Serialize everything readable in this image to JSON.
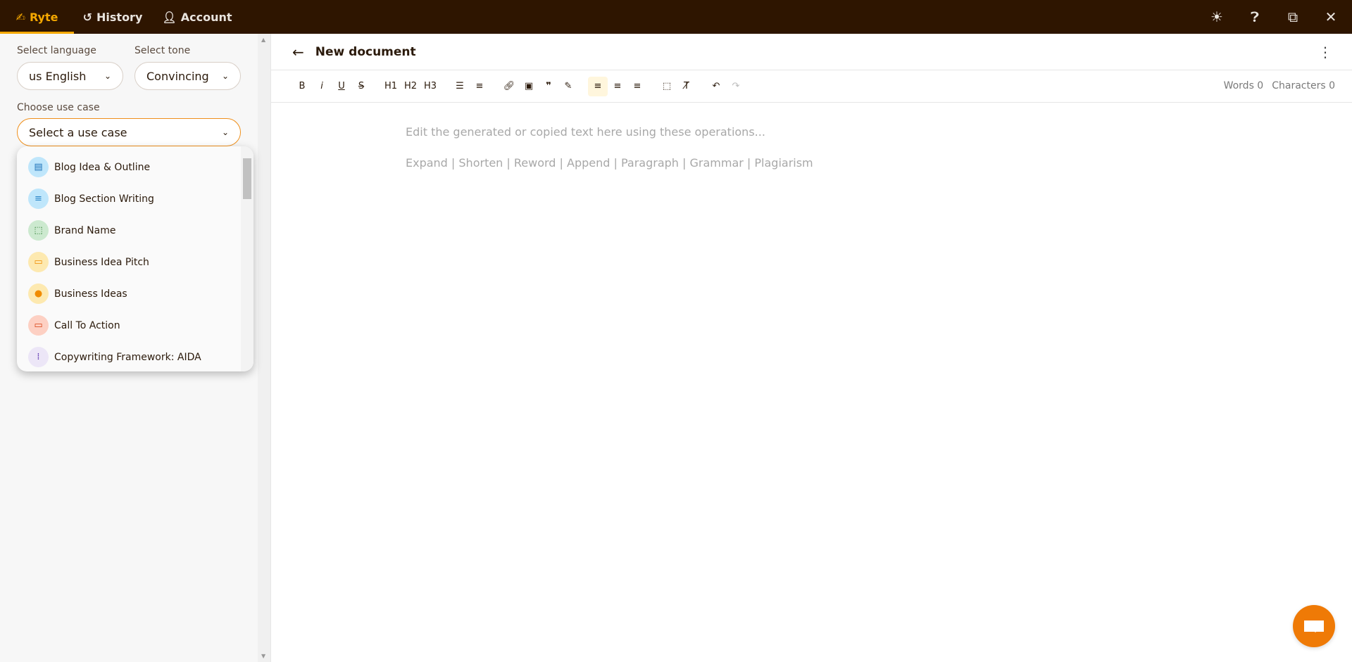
{
  "topbar": {
    "tabs": [
      {
        "label": "Ryte",
        "icon": "writing-hand-icon"
      },
      {
        "label": "History",
        "icon": "history-icon"
      },
      {
        "label": "Account",
        "icon": "person-icon"
      }
    ],
    "icons": [
      "brightness-icon",
      "help-icon",
      "open-external-icon",
      "close-icon"
    ]
  },
  "sidebar": {
    "language_label": "Select language",
    "language_value": "us English",
    "tone_label": "Select tone",
    "tone_value": "Convincing",
    "usecase_label": "Choose use case",
    "usecase_placeholder": "Select a use case",
    "usecases": [
      {
        "label": "Blog Idea & Outline",
        "icon": "article-icon",
        "bg": "#bfe6fb",
        "fg": "#1e73b8"
      },
      {
        "label": "Blog Section Writing",
        "icon": "notes-icon",
        "bg": "#bfe6fb",
        "fg": "#2b86c8"
      },
      {
        "label": "Brand Name",
        "icon": "select-area-icon",
        "bg": "#cce9cf",
        "fg": "#2e7d32"
      },
      {
        "label": "Business Idea Pitch",
        "icon": "presentation-icon",
        "bg": "#fde9b0",
        "fg": "#f08c00"
      },
      {
        "label": "Business Ideas",
        "icon": "lightbulb-icon",
        "bg": "#fde9b0",
        "fg": "#f08c00"
      },
      {
        "label": "Call To Action",
        "icon": "cta-icon",
        "bg": "#fdd0c3",
        "fg": "#d84315"
      },
      {
        "label": "Copywriting Framework: AIDA",
        "icon": "framework-icon",
        "bg": "#ece6f7",
        "fg": "#5e35b1"
      }
    ]
  },
  "document": {
    "title": "New document",
    "toolbar": [
      "B",
      "i",
      "U",
      "S",
      "H1",
      "H2",
      "H3"
    ],
    "words_label": "Words 0",
    "chars_label": "Characters 0",
    "placeholder_1": "Edit the generated or copied text here using these operations...",
    "placeholder_2": "Expand | Shorten | Reword | Append | Paragraph | Grammar | Plagiarism"
  },
  "colors": {
    "topbar": "#2e1500",
    "accent": "#f5a800",
    "chat": "#ef7a06"
  }
}
